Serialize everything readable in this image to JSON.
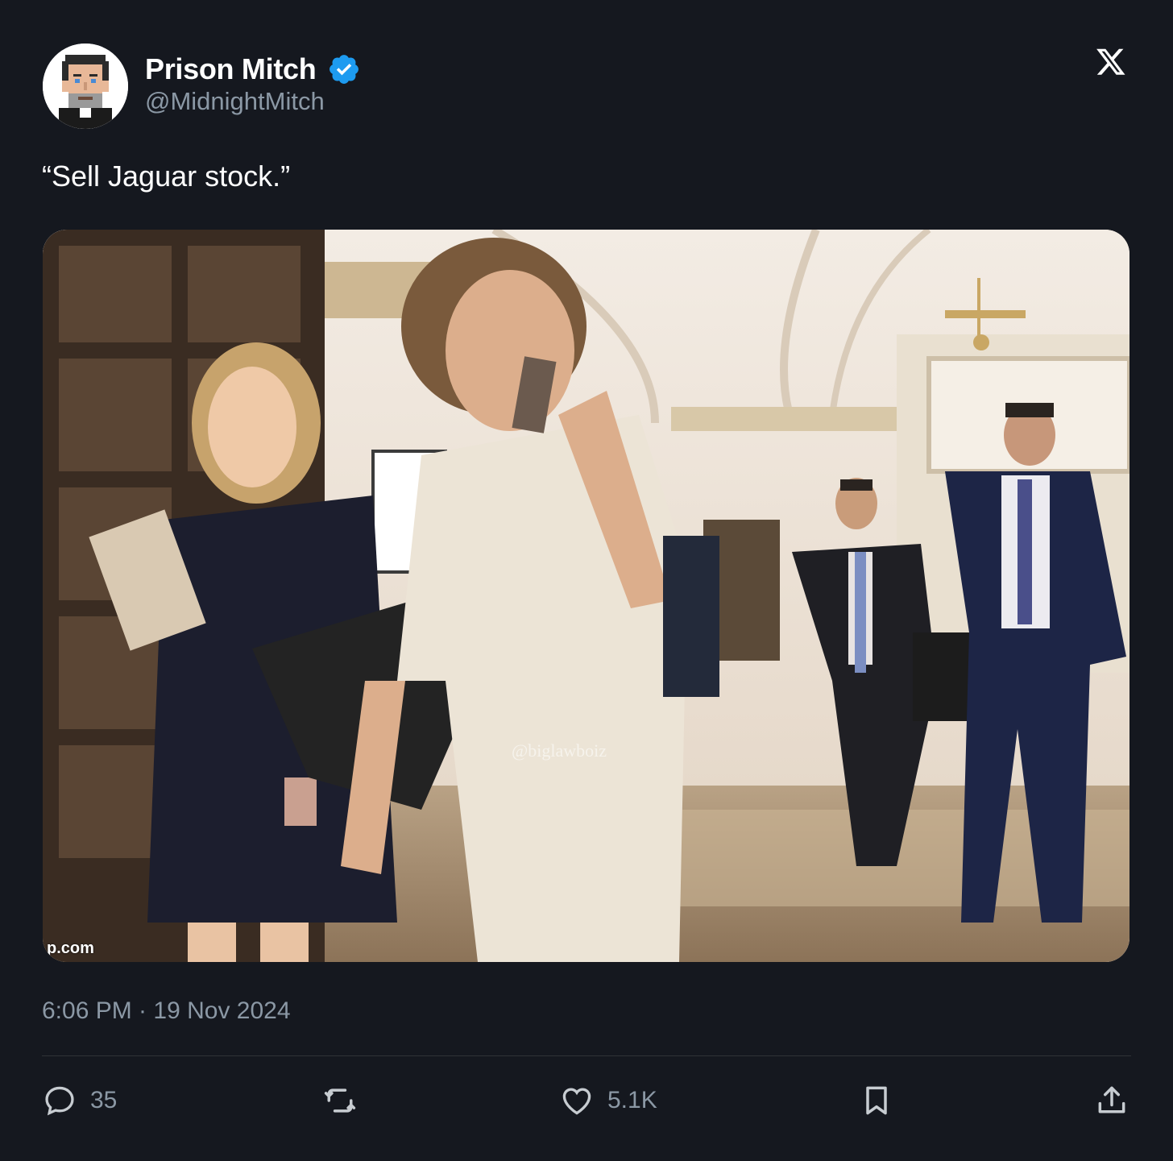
{
  "author": {
    "display_name": "Prison Mitch",
    "handle": "@MidnightMitch",
    "verified": true,
    "avatar_icon": "pixel-portrait-avatar"
  },
  "platform_icon": "x-logo-icon",
  "tweet": {
    "text": "“Sell Jaguar stock.”",
    "timestamp": "6:06 PM · 19 Nov 2024"
  },
  "media": {
    "description_icon": "photo-media",
    "watermark": "@biglawboiz",
    "corner_text": "p.com"
  },
  "actions": {
    "reply_count": "35",
    "like_count": "5.1K"
  },
  "colors": {
    "background": "#15181f",
    "verified_blue": "#1d9bf0",
    "muted_text": "#8b98a5"
  }
}
